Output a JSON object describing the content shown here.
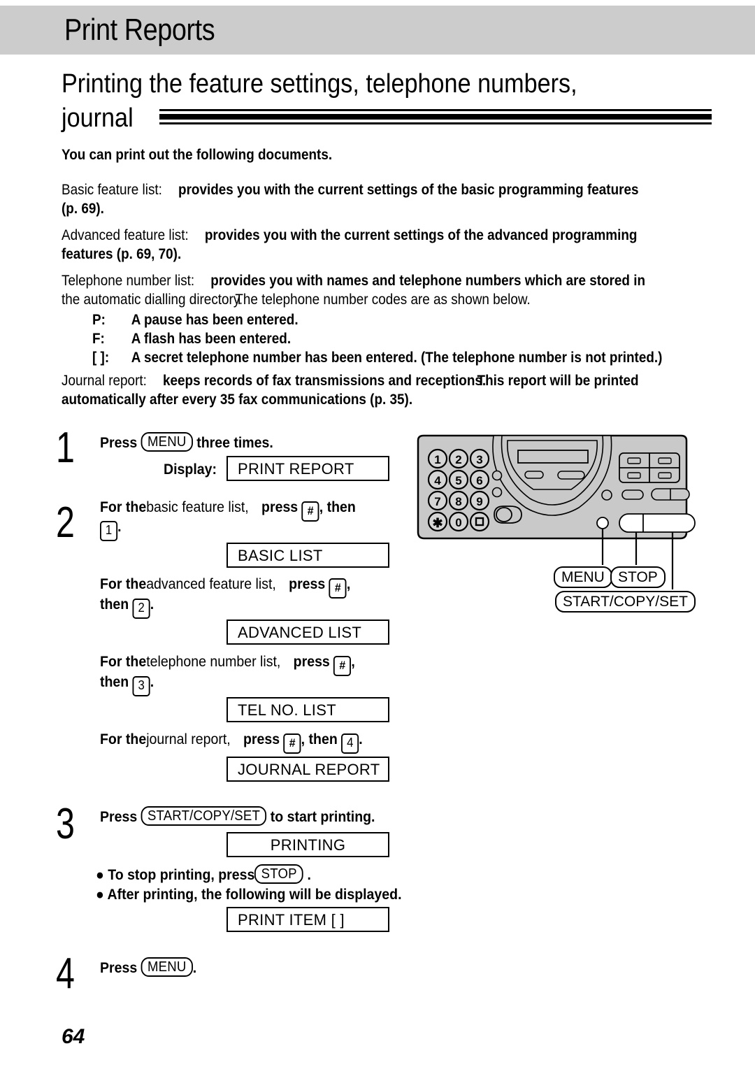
{
  "header": {
    "title": "Print Reports"
  },
  "section": {
    "title_line1": "Printing the feature settings, telephone numbers,",
    "title_line2": "journal"
  },
  "intro": {
    "lead": "You can print out the following documents."
  },
  "descriptions": [
    {
      "label": "Basic feature list:",
      "body_line1": "provides you with the current settings of the basic programming features",
      "body_line2": "(p. 69)."
    },
    {
      "label": "Advanced feature list:",
      "body_line1": "provides you with the current settings of the advanced programming",
      "body_line2": "features (p. 69, 70)."
    },
    {
      "label": "Telephone number list:",
      "body_line1": "provides you with names and telephone numbers which are stored in",
      "body_line2a": "the automatic dialling directory.",
      "body_line2b": "The telephone number codes are as shown below.",
      "codes": [
        {
          "code": "P:",
          "meaning": "A pause has been entered."
        },
        {
          "code": "F:",
          "meaning": "A flash has been entered."
        },
        {
          "code": "[  ]:",
          "meaning": "A secret telephone number has been entered. (The telephone number is not printed.)"
        }
      ]
    },
    {
      "label": "Journal report:",
      "body_line1a": "keeps records of fax transmissions and receptions.",
      "body_line1b": "This report will be printed",
      "body_line2": "automatically after every 35 fax communications (p. 35)."
    }
  ],
  "steps": {
    "step1": {
      "number": "1",
      "press_word": "Press",
      "key": "MENU",
      "suffix": "three times.",
      "display_label": "Display:",
      "display_value": "PRINT REPORT"
    },
    "step2": {
      "number": "2",
      "items": [
        {
          "for_the": "For the",
          "subject": "basic feature list,",
          "press_word": "press",
          "key_hash": "#",
          "then_word": ", then",
          "digit": "1",
          "period": ".",
          "display_value": "BASIC LIST"
        },
        {
          "for_the": "For the",
          "subject": "advanced feature list,",
          "press_word": "press",
          "key_hash": "#",
          "then_word": "then",
          "digit": "2",
          "period": ".",
          "display_value": "ADVANCED LIST"
        },
        {
          "for_the": "For the",
          "subject": "telephone number list,",
          "press_word": "press",
          "key_hash": "#",
          "then_word": "then",
          "digit": "3",
          "period": ".",
          "display_value": "TEL NO. LIST"
        },
        {
          "for_the": "For the",
          "subject": "journal report,",
          "press_word": "press",
          "key_hash": "#",
          "then_word": ", then",
          "digit": "4",
          "period": ".",
          "display_value": "JOURNAL REPORT"
        }
      ]
    },
    "step3": {
      "number": "3",
      "press_word": "Press",
      "key": "START/COPY/SET",
      "suffix": "to start printing.",
      "display_value": "PRINTING",
      "note1_pre": "To stop printing, press",
      "note1_key": "STOP",
      "note1_post": ".",
      "note2": "After printing, the following will be displayed.",
      "display_value2": "PRINT ITEM [ ]"
    },
    "step4": {
      "number": "4",
      "press_word": "Press",
      "key": "MENU",
      "suffix": "."
    }
  },
  "diagram": {
    "keypad": [
      "1",
      "2",
      "3",
      "4",
      "5",
      "6",
      "7",
      "8",
      "9",
      "✱",
      "0",
      "#"
    ],
    "callouts": [
      {
        "label": "MENU"
      },
      {
        "label": "STOP"
      },
      {
        "label": "START/COPY/SET"
      }
    ],
    "colors": {
      "body": "#c9c9c9",
      "outline": "#000000",
      "key_fill": "#d6d6d6"
    }
  },
  "footer": {
    "page_number": "64"
  }
}
